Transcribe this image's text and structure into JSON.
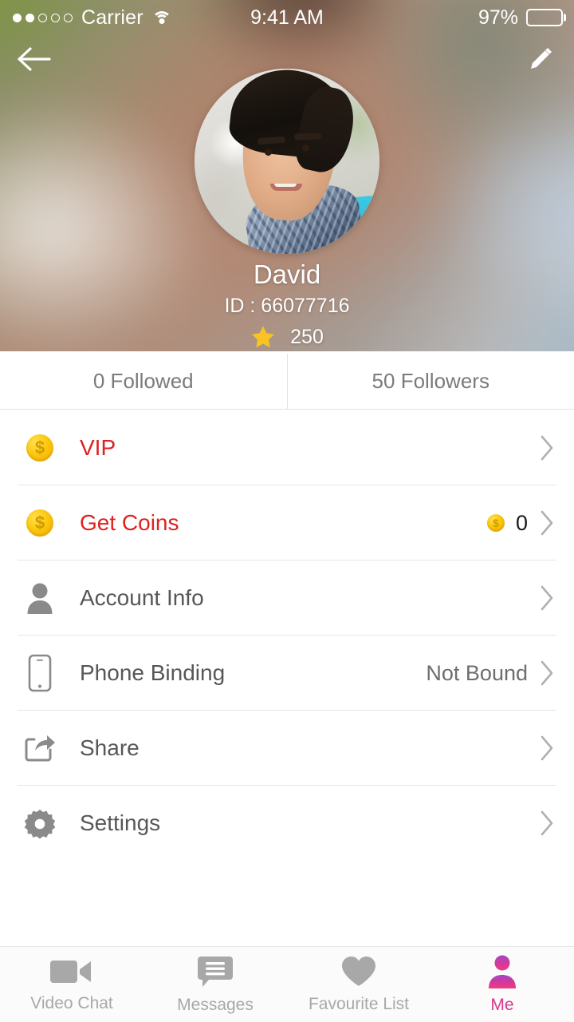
{
  "status_bar": {
    "carrier": "Carrier",
    "signal_dots_total": 5,
    "signal_dots_filled": 2,
    "wifi_icon": "wifi-icon",
    "time": "9:41 AM",
    "battery_percent": "97%",
    "battery_level": 97
  },
  "navbar": {
    "back_icon": "arrow-left-icon",
    "edit_icon": "pencil-icon"
  },
  "profile": {
    "avatar_alt": "user-avatar-photo",
    "name": "David",
    "id_label": "ID : 66077716",
    "star_icon": "star-icon",
    "star_count": "250"
  },
  "follow_tabs": [
    {
      "label": "0 Followed",
      "name": "tab-followed"
    },
    {
      "label": "50 Followers",
      "name": "tab-followers"
    }
  ],
  "menu": [
    {
      "name": "menu-item-vip",
      "label": "VIP",
      "icon": "coin-dollar-icon",
      "icon_text": "$",
      "accent": true,
      "value": "",
      "has_value_coin": false,
      "chevron": "chevron-right-icon"
    },
    {
      "name": "menu-item-get-coins",
      "label": "Get Coins",
      "icon": "coin-dollar-icon",
      "icon_text": "$",
      "accent": true,
      "value": "0",
      "has_value_coin": true,
      "chevron": "chevron-right-icon"
    },
    {
      "name": "menu-item-account-info",
      "label": "Account Info",
      "icon": "person-icon",
      "icon_text": "",
      "accent": false,
      "value": "",
      "has_value_coin": false,
      "chevron": "chevron-right-icon"
    },
    {
      "name": "menu-item-phone-binding",
      "label": "Phone Binding",
      "icon": "phone-icon",
      "icon_text": "",
      "accent": false,
      "value": "Not Bound",
      "has_value_coin": false,
      "chevron": "chevron-right-icon"
    },
    {
      "name": "menu-item-share",
      "label": "Share",
      "icon": "share-icon",
      "icon_text": "",
      "accent": false,
      "value": "",
      "has_value_coin": false,
      "chevron": "chevron-right-icon"
    },
    {
      "name": "menu-item-settings",
      "label": "Settings",
      "icon": "gear-icon",
      "icon_text": "",
      "accent": false,
      "value": "",
      "has_value_coin": false,
      "chevron": "chevron-right-icon"
    }
  ],
  "tabbar": [
    {
      "name": "tab-video-chat",
      "label": "Video Chat",
      "icon": "video-camera-icon",
      "active": false
    },
    {
      "name": "tab-messages",
      "label": "Messages",
      "icon": "message-bubble-icon",
      "active": false
    },
    {
      "name": "tab-favourite-list",
      "label": "Favourite List",
      "icon": "heart-icon",
      "active": false
    },
    {
      "name": "tab-me",
      "label": "Me",
      "icon": "person-icon",
      "active": true
    }
  ],
  "colors": {
    "accent_red": "#e02120",
    "coin_gold": "#fcc80f",
    "star_gold": "#f7c325",
    "active_tab_pink": "#d8378e",
    "inactive_icon_grey": "#a8a8a8",
    "menu_text_grey": "#575757"
  }
}
